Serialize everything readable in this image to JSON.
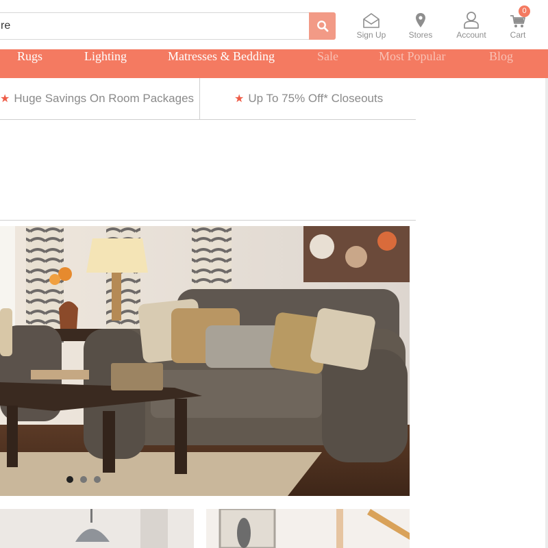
{
  "header": {
    "search": {
      "value": "re",
      "placeholder": ""
    },
    "utilities": [
      {
        "label": "Sign Up",
        "icon": "envelope-icon"
      },
      {
        "label": "Stores",
        "icon": "map-pin-icon"
      },
      {
        "label": "Account",
        "icon": "user-icon"
      },
      {
        "label": "Cart",
        "icon": "cart-icon",
        "badge": "0"
      }
    ]
  },
  "nav": {
    "items": [
      {
        "label": "Rugs"
      },
      {
        "label": "Lighting"
      },
      {
        "label": "Matresses & Bedding"
      },
      {
        "label": "Sale"
      },
      {
        "label": "Most Popular"
      },
      {
        "label": "Blog"
      }
    ],
    "background": "#f47a61"
  },
  "promo": {
    "items": [
      {
        "label": "Huge Savings On Room Packages"
      },
      {
        "label": "Up To 75% Off* Closeouts"
      }
    ]
  },
  "carousel": {
    "slides": 3,
    "active": 1
  },
  "colors": {
    "accent": "#f47a61",
    "search_button": "#f29a86",
    "star": "#ee5c47"
  }
}
